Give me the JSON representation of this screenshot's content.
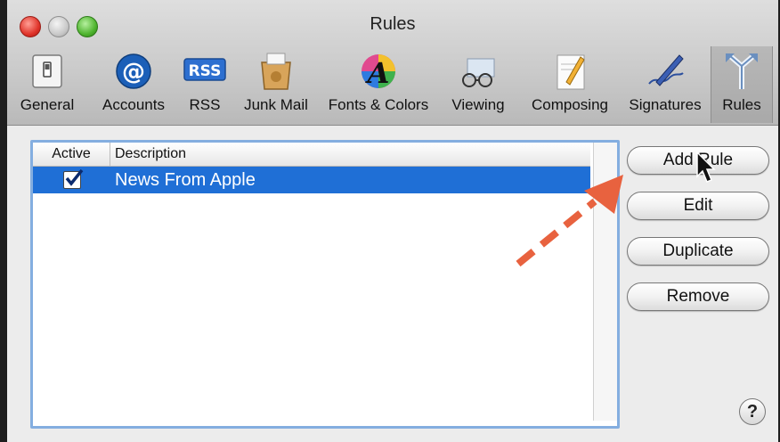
{
  "window": {
    "title": "Rules"
  },
  "toolbar": {
    "items": [
      {
        "label": "General",
        "icon": "general-switch-icon"
      },
      {
        "label": "Accounts",
        "icon": "at-sign-icon"
      },
      {
        "label": "RSS",
        "icon": "rss-icon"
      },
      {
        "label": "Junk Mail",
        "icon": "junk-mail-icon"
      },
      {
        "label": "Fonts & Colors",
        "icon": "fonts-colors-icon"
      },
      {
        "label": "Viewing",
        "icon": "viewing-glasses-icon"
      },
      {
        "label": "Composing",
        "icon": "composing-pencil-icon"
      },
      {
        "label": "Signatures",
        "icon": "signatures-pen-icon"
      },
      {
        "label": "Rules",
        "icon": "rules-arrows-icon"
      }
    ],
    "selected": "Rules",
    "rss_badge": "RSS"
  },
  "table": {
    "columns": [
      "Active",
      "Description"
    ],
    "rows": [
      {
        "active": true,
        "description": "News From Apple",
        "selected": true
      }
    ]
  },
  "buttons": {
    "add_rule": "Add Rule",
    "edit": "Edit",
    "duplicate": "Duplicate",
    "remove": "Remove",
    "help": "?"
  },
  "colors": {
    "selection": "#1f6fd6",
    "focus_ring": "#84aee0",
    "annotation_arrow": "#e8623f"
  }
}
